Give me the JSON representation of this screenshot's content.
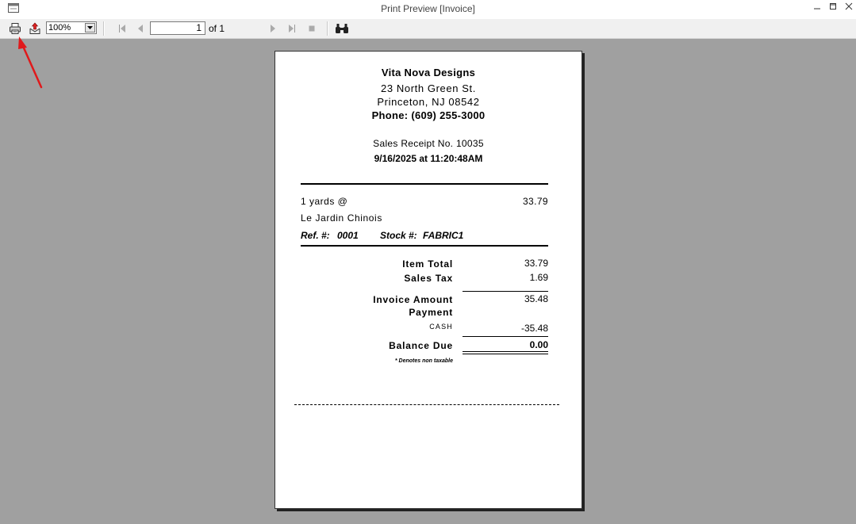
{
  "window": {
    "title": "Print Preview [Invoice]"
  },
  "toolbar": {
    "zoom": "100%",
    "page_current": "1",
    "page_total": "of 1"
  },
  "receipt": {
    "store_name": "Vita Nova Designs",
    "address": "23 North Green St.",
    "city_state_zip": "Princeton, NJ  08542",
    "phone": "Phone: (609) 255-3000",
    "receipt_number": "Sales Receipt No. 10035",
    "date_time": "9/16/2025 at 11:20:48AM",
    "line_item": {
      "quantity": "1 yards @",
      "amount": "33.79",
      "description": "Le Jardin Chinois",
      "ref_label": "Ref. #:",
      "ref_value": "0001",
      "stock_label": "Stock #:",
      "stock_value": "FABRIC1"
    },
    "totals": {
      "item_total_label": "Item Total",
      "item_total": "33.79",
      "sales_tax_label": "Sales Tax",
      "sales_tax": "1.69",
      "invoice_amount_label": "Invoice Amount",
      "invoice_amount": "35.48",
      "payment_label": "Payment",
      "payment_method": "CASH",
      "payment_amount": "-35.48",
      "balance_due_label": "Balance Due",
      "balance_due": "0.00"
    },
    "footnote": "* Denotes non taxable"
  },
  "colors": {
    "workspace": "#a0a0a0",
    "annotation_arrow": "#e0191b"
  }
}
